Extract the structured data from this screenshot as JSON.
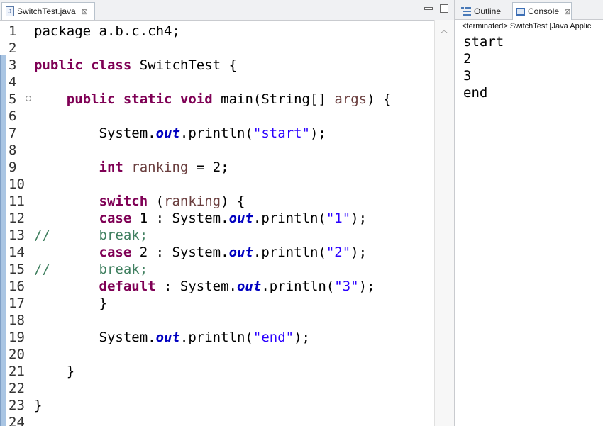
{
  "editor": {
    "tab_label": "SwitchTest.java",
    "tab_icon": "java-file-icon",
    "close_glyph": "⊠",
    "lines": [
      {
        "n": "1",
        "segs": [
          {
            "c": "plain",
            "t": "package a.b.c.ch4;"
          }
        ]
      },
      {
        "n": "2",
        "segs": []
      },
      {
        "n": "3",
        "segs": [
          {
            "c": "kw",
            "t": "public"
          },
          {
            "c": "plain",
            "t": " "
          },
          {
            "c": "kw",
            "t": "class"
          },
          {
            "c": "plain",
            "t": " SwitchTest {"
          }
        ]
      },
      {
        "n": "4",
        "segs": []
      },
      {
        "n": "5",
        "segs": [
          {
            "c": "plain",
            "t": "    "
          },
          {
            "c": "kw",
            "t": "public"
          },
          {
            "c": "plain",
            "t": " "
          },
          {
            "c": "kw",
            "t": "static"
          },
          {
            "c": "plain",
            "t": " "
          },
          {
            "c": "kw",
            "t": "void"
          },
          {
            "c": "plain",
            "t": " main(String[] "
          },
          {
            "c": "var",
            "t": "args"
          },
          {
            "c": "plain",
            "t": ") {"
          }
        ],
        "fold": true
      },
      {
        "n": "6",
        "segs": []
      },
      {
        "n": "7",
        "segs": [
          {
            "c": "plain",
            "t": "        System."
          },
          {
            "c": "fld",
            "t": "out"
          },
          {
            "c": "plain",
            "t": ".println("
          },
          {
            "c": "str",
            "t": "\"start\""
          },
          {
            "c": "plain",
            "t": ");"
          }
        ]
      },
      {
        "n": "8",
        "segs": []
      },
      {
        "n": "9",
        "segs": [
          {
            "c": "plain",
            "t": "        "
          },
          {
            "c": "kw",
            "t": "int"
          },
          {
            "c": "plain",
            "t": " "
          },
          {
            "c": "var",
            "t": "ranking"
          },
          {
            "c": "plain",
            "t": " = 2;"
          }
        ]
      },
      {
        "n": "10",
        "segs": []
      },
      {
        "n": "11",
        "segs": [
          {
            "c": "plain",
            "t": "        "
          },
          {
            "c": "kw",
            "t": "switch"
          },
          {
            "c": "plain",
            "t": " ("
          },
          {
            "c": "var",
            "t": "ranking"
          },
          {
            "c": "plain",
            "t": ") {"
          }
        ]
      },
      {
        "n": "12",
        "segs": [
          {
            "c": "plain",
            "t": "        "
          },
          {
            "c": "kw",
            "t": "case"
          },
          {
            "c": "plain",
            "t": " 1 : System."
          },
          {
            "c": "fld",
            "t": "out"
          },
          {
            "c": "plain",
            "t": ".println("
          },
          {
            "c": "str",
            "t": "\"1\""
          },
          {
            "c": "plain",
            "t": ");"
          }
        ]
      },
      {
        "n": "13",
        "comment": "//      break;"
      },
      {
        "n": "14",
        "segs": [
          {
            "c": "plain",
            "t": "        "
          },
          {
            "c": "kw",
            "t": "case"
          },
          {
            "c": "plain",
            "t": " 2 : System."
          },
          {
            "c": "fld",
            "t": "out"
          },
          {
            "c": "plain",
            "t": ".println("
          },
          {
            "c": "str",
            "t": "\"2\""
          },
          {
            "c": "plain",
            "t": ");"
          }
        ]
      },
      {
        "n": "15",
        "comment": "//      break;"
      },
      {
        "n": "16",
        "segs": [
          {
            "c": "plain",
            "t": "        "
          },
          {
            "c": "kw",
            "t": "default"
          },
          {
            "c": "plain",
            "t": " : System."
          },
          {
            "c": "fld",
            "t": "out"
          },
          {
            "c": "plain",
            "t": ".println("
          },
          {
            "c": "str",
            "t": "\"3\""
          },
          {
            "c": "plain",
            "t": ");"
          }
        ]
      },
      {
        "n": "17",
        "segs": [
          {
            "c": "plain",
            "t": "        }"
          }
        ]
      },
      {
        "n": "18",
        "segs": []
      },
      {
        "n": "19",
        "segs": [
          {
            "c": "plain",
            "t": "        System."
          },
          {
            "c": "fld",
            "t": "out"
          },
          {
            "c": "plain",
            "t": ".println("
          },
          {
            "c": "str",
            "t": "\"end\""
          },
          {
            "c": "plain",
            "t": ");"
          }
        ]
      },
      {
        "n": "20",
        "segs": []
      },
      {
        "n": "21",
        "segs": [
          {
            "c": "plain",
            "t": "    }"
          }
        ]
      },
      {
        "n": "22",
        "segs": []
      },
      {
        "n": "23",
        "segs": [
          {
            "c": "plain",
            "t": "}"
          }
        ]
      },
      {
        "n": "24",
        "segs": []
      }
    ]
  },
  "views": {
    "outline_label": "Outline",
    "console_label": "Console",
    "close_glyph": "⊠",
    "console_status": "<terminated> SwitchTest [Java Applic",
    "console_output": [
      "start",
      "2",
      "3",
      "end"
    ]
  },
  "colors": {
    "keyword": "#7f0055",
    "string": "#2a00ff",
    "field": "#0000c0",
    "local_variable": "#6a3e3e",
    "comment": "#3f7f5f"
  }
}
